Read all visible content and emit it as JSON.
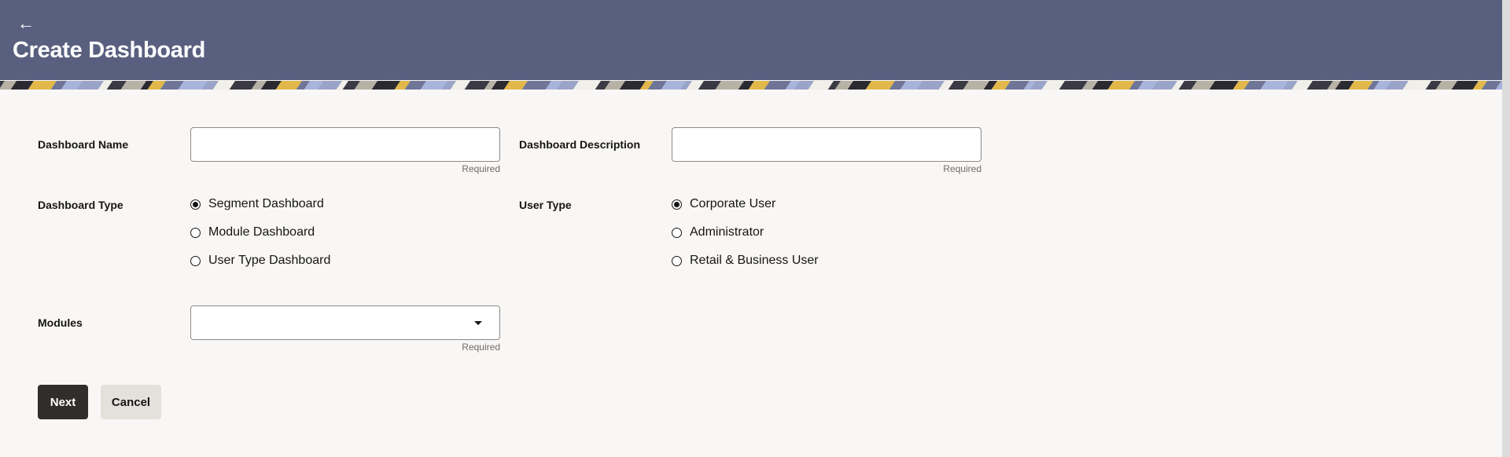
{
  "header": {
    "back_icon": "arrow-left-icon",
    "title": "Create Dashboard"
  },
  "form": {
    "dashboard_name": {
      "label": "Dashboard Name",
      "value": "",
      "hint": "Required"
    },
    "dashboard_description": {
      "label": "Dashboard Description",
      "value": "",
      "hint": "Required"
    },
    "dashboard_type": {
      "label": "Dashboard Type",
      "options": [
        "Segment Dashboard",
        "Module Dashboard",
        "User Type Dashboard"
      ],
      "selected": "Segment Dashboard"
    },
    "user_type": {
      "label": "User Type",
      "options": [
        "Corporate User",
        "Administrator",
        "Retail & Business User"
      ],
      "selected": "Corporate User"
    },
    "modules": {
      "label": "Modules",
      "value": "",
      "hint": "Required"
    }
  },
  "actions": {
    "next_label": "Next",
    "cancel_label": "Cancel"
  },
  "colors": {
    "header_bg": "#59607f",
    "primary_button": "#312d2a",
    "secondary_button": "#e4e1dd",
    "page_bg": "#f8f7f5"
  }
}
